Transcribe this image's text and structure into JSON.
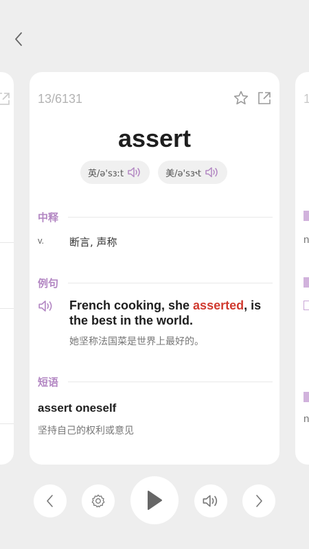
{
  "card": {
    "counter": "13/6131",
    "word": "assert",
    "phonetics": {
      "uk": "英/ə'sɜːt",
      "us": "美/ə'sɜ˞t"
    },
    "meaning_section": {
      "title": "中释",
      "pos": "v.",
      "definition": "断言, 声称"
    },
    "example_section": {
      "title": "例句",
      "before": "French cooking, she ",
      "highlight": "asserted",
      "after": ", is the best in the world.",
      "translation": "她坚称法国菜是世界上最好的。"
    },
    "phrase_section": {
      "title": "短语",
      "phrase": "assert oneself",
      "meaning": "坚持自己的权利或意见"
    }
  },
  "colors": {
    "accent": "#b387c3",
    "highlight": "#d03a2f"
  },
  "icons": {
    "back": "chevron-left-icon",
    "favorite": "star-outline-icon",
    "share": "external-link-icon",
    "speaker": "speaker-icon",
    "settings": "gear-icon",
    "play": "play-icon",
    "prev": "chevron-left-icon",
    "next": "chevron-right-icon"
  }
}
